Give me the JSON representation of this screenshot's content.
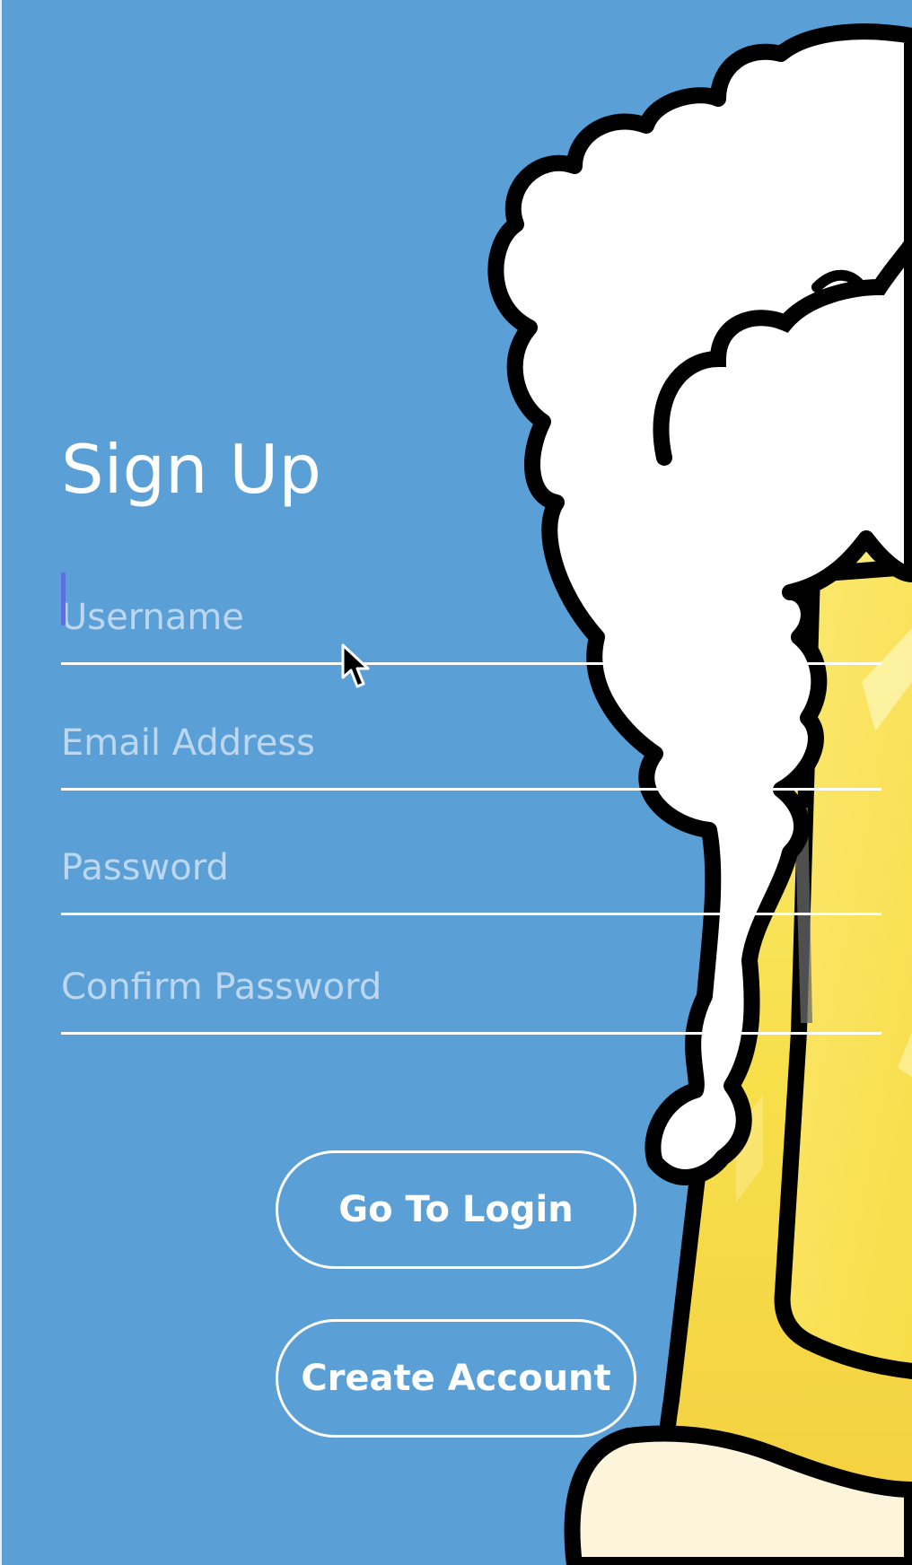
{
  "form": {
    "title": "Sign Up",
    "fields": {
      "username": {
        "placeholder": "Username",
        "value": ""
      },
      "email": {
        "placeholder": "Email Address",
        "value": ""
      },
      "password": {
        "placeholder": "Password",
        "value": ""
      },
      "confirm_password": {
        "placeholder": "Confirm Password",
        "value": ""
      }
    },
    "focused_field": "username"
  },
  "buttons": {
    "go_to_login": "Go To Login",
    "create_account": "Create Account"
  },
  "illustration": {
    "name": "beer-mug-with-foam-icon"
  },
  "colors": {
    "background": "#5aa0d6",
    "text": "#ffffff",
    "placeholder": "#c6dcf0",
    "caret": "#5b6fe0",
    "beer": "#f7df4a",
    "foam": "#ffffff",
    "outline": "#000000"
  }
}
